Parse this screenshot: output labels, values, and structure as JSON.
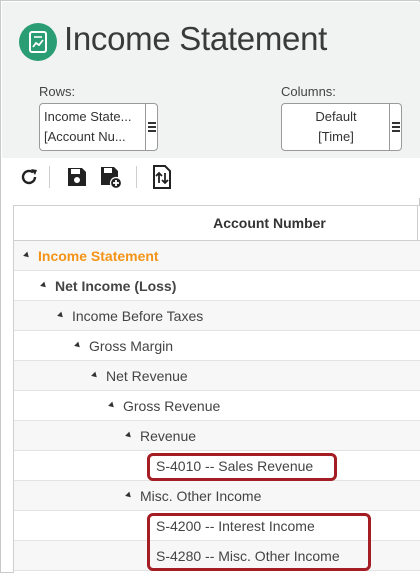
{
  "header": {
    "title": "Income Statement",
    "icon": "report-chart-icon",
    "icon_color": "#2a9d74"
  },
  "selectors": {
    "rows_label": "Rows:",
    "rows_line1": "Income State...",
    "rows_line2": "[Account Nu...",
    "columns_label": "Columns:",
    "columns_line1": "Default",
    "columns_line2": "[Time]"
  },
  "toolbar": {
    "buttons": [
      "refresh-icon",
      "save-icon",
      "save-add-icon",
      "swap-axes-icon"
    ]
  },
  "grid": {
    "column_header": "Account Number",
    "rows": [
      {
        "label": "Income Statement",
        "style": "orange",
        "expandable": true
      },
      {
        "label": "Net Income (Loss)",
        "style": "bold",
        "expandable": true
      },
      {
        "label": "Income Before Taxes",
        "style": "normal",
        "expandable": true
      },
      {
        "label": "Gross Margin",
        "style": "normal",
        "expandable": true
      },
      {
        "label": "Net Revenue",
        "style": "normal",
        "expandable": true
      },
      {
        "label": "Gross Revenue",
        "style": "normal",
        "expandable": true
      },
      {
        "label": "Revenue",
        "style": "normal",
        "expandable": true
      },
      {
        "label": "S-4010 -- Sales Revenue",
        "style": "normal",
        "expandable": false,
        "highlighted": true
      },
      {
        "label": "Misc. Other Income",
        "style": "normal",
        "expandable": true
      },
      {
        "label": "S-4200 -- Interest Income",
        "style": "normal",
        "expandable": false,
        "highlighted": true
      },
      {
        "label": "S-4280 -- Misc. Other Income",
        "style": "normal",
        "expandable": false,
        "highlighted": true
      }
    ]
  },
  "colors": {
    "accent_orange": "#f39418",
    "highlight_red": "#a51d24"
  }
}
